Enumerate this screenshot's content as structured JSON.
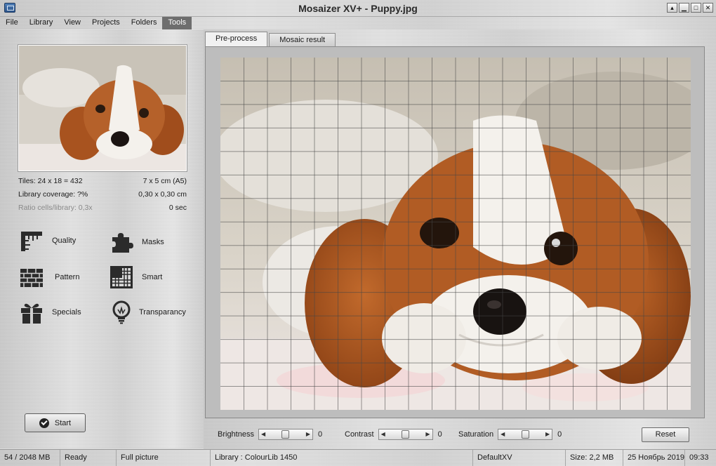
{
  "window": {
    "title": "Mosaizer XV+  - Puppy.jpg",
    "minimize_glyph": "▴",
    "restore_glyph": "▁",
    "maximize_glyph": "□",
    "close_glyph": "✕"
  },
  "menu": [
    "File",
    "Library",
    "View",
    "Projects",
    "Folders",
    "Tools"
  ],
  "info": {
    "tiles_label": "Tiles: 24 x 18 = 432",
    "size_cm": "7 x 5 cm  (A5)",
    "coverage_label": "Library coverage: ?%",
    "cell_size": "0,30 x 0,30 cm",
    "ratio_label": "Ratio cells/library: 0,3x",
    "time": "0 sec"
  },
  "tools": [
    {
      "label": "Quality",
      "icon": "ruler-icon"
    },
    {
      "label": "Masks",
      "icon": "puzzle-icon"
    },
    {
      "label": "Pattern",
      "icon": "brick-wall-icon"
    },
    {
      "label": "Smart",
      "icon": "grid-icon"
    },
    {
      "label": "Specials",
      "icon": "gift-icon"
    },
    {
      "label": "Transparancy",
      "icon": "light-bulb-icon"
    }
  ],
  "start_label": "Start",
  "tabs": [
    {
      "label": "Pre-process",
      "active": true
    },
    {
      "label": "Mosaic result",
      "active": false
    }
  ],
  "grid": {
    "columns": 20,
    "rows": 15
  },
  "adjust": {
    "brightness": {
      "label": "Brightness",
      "value": "0",
      "level": 0.5
    },
    "contrast": {
      "label": "Contrast",
      "value": "0",
      "level": 0.5
    },
    "saturation": {
      "label": "Saturation",
      "value": "0",
      "level": 0.5
    },
    "reset_label": "Reset",
    "left_arrow": "◀",
    "right_arrow": "▶"
  },
  "status": {
    "memory": "54 / 2048 MB",
    "state": "Ready",
    "view_mode": "Full picture",
    "library": "Library  : ColourLib 1450",
    "profile": "DefaultXV",
    "size": "Size: 2,2 MB",
    "date": "25 Ноябрь 2019",
    "time": "09:33"
  },
  "colors": {
    "menu_active": "#6e6e6e",
    "fur_brown": "#a8531f",
    "fur_white": "#f4f1ec",
    "blanket": "#e9e2dc"
  }
}
